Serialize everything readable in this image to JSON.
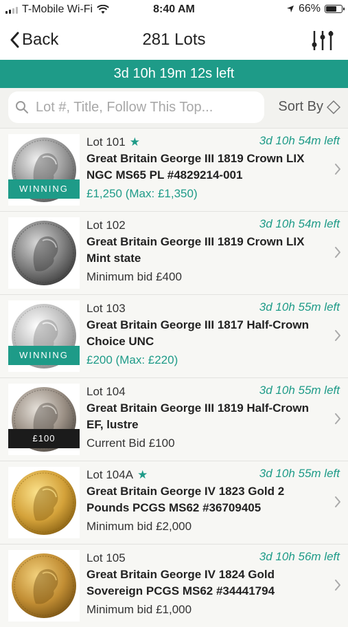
{
  "status_bar": {
    "carrier": "T-Mobile Wi-Fi",
    "time": "8:40 AM",
    "battery_text": "66%",
    "battery_level": 0.66
  },
  "nav": {
    "back_label": "Back",
    "title": "281 Lots"
  },
  "timer_banner": "3d 10h 19m 12s left",
  "search": {
    "placeholder": "Lot #, Title, Follow This Top...",
    "value": ""
  },
  "sort_label": "Sort By",
  "colors": {
    "accent": "#1e9b88",
    "dark_badge": "#1b1b1b"
  },
  "lots": [
    {
      "lot": "Lot 101",
      "starred": true,
      "time_left": "3d 10h 54m left",
      "title": "Great Britain George III 1819 Crown LIX NGC MS65 PL #4829214-001",
      "price": "£1,250 (Max: £1,350)",
      "price_style": "teal",
      "badge": "WINNING",
      "badge_style": "winning",
      "coin": "silver"
    },
    {
      "lot": "Lot 102",
      "starred": false,
      "time_left": "3d 10h 54m left",
      "title": "Great Britain George III 1819 Crown LIX Mint state",
      "price": "Minimum bid £400",
      "price_style": "plain",
      "badge": "",
      "badge_style": "",
      "coin": "silver-dark"
    },
    {
      "lot": "Lot 103",
      "starred": false,
      "time_left": "3d 10h 55m left",
      "title": "Great Britain George III 1817 Half-Crown Choice UNC",
      "price": "£200 (Max: £220)",
      "price_style": "teal",
      "badge": "WINNING",
      "badge_style": "winning",
      "coin": "silver-light"
    },
    {
      "lot": "Lot 104",
      "starred": false,
      "time_left": "3d 10h 55m left",
      "title": "Great Britain George III 1819 Half-Crown EF, lustre",
      "price": "Current Bid £100",
      "price_style": "plain",
      "badge": "£100",
      "badge_style": "bid",
      "coin": "silver-toned"
    },
    {
      "lot": "Lot 104A",
      "starred": true,
      "time_left": "3d 10h 55m left",
      "title": "Great Britain George IV 1823 Gold 2 Pounds PCGS MS62 #36709405",
      "price": "Minimum bid £2,000",
      "price_style": "plain",
      "badge": "",
      "badge_style": "",
      "coin": "gold"
    },
    {
      "lot": "Lot 105",
      "starred": false,
      "time_left": "3d 10h 56m left",
      "title": "Great Britain George IV 1824 Gold Sovereign PCGS MS62 #34441794",
      "price": "Minimum bid £1,000",
      "price_style": "plain",
      "badge": "",
      "badge_style": "",
      "coin": "gold-dark"
    }
  ]
}
